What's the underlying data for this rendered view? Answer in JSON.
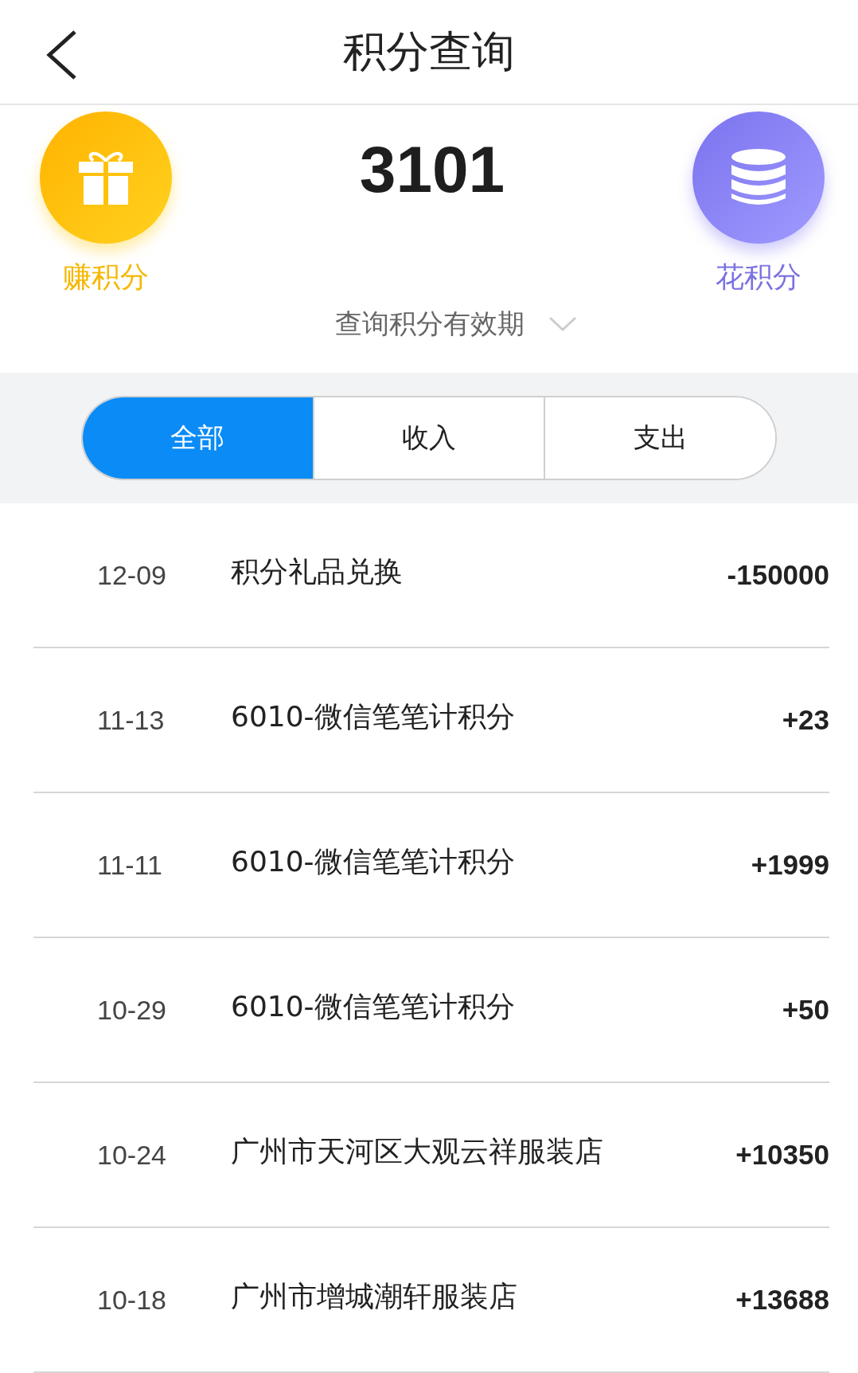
{
  "header": {
    "title": "积分查询"
  },
  "summary": {
    "points": "3101",
    "earn_label": "赚积分",
    "spend_label": "花积分",
    "expiry_link": "查询积分有效期"
  },
  "tabs": [
    {
      "label": "全部",
      "selected": true
    },
    {
      "label": "收入",
      "selected": false
    },
    {
      "label": "支出",
      "selected": false
    }
  ],
  "records": [
    {
      "date": "12-09",
      "description": "积分礼品兑换",
      "amount": "-150000"
    },
    {
      "date": "11-13",
      "description": "6010-微信笔笔计积分",
      "amount": "+23"
    },
    {
      "date": "11-11",
      "description": "6010-微信笔笔计积分",
      "amount": "+1999"
    },
    {
      "date": "10-29",
      "description": "6010-微信笔笔计积分",
      "amount": "+50"
    },
    {
      "date": "10-24",
      "description": "广州市天河区大观云祥服装店",
      "amount": "+10350"
    },
    {
      "date": "10-18",
      "description": "广州市增城潮轩服装店",
      "amount": "+13688"
    }
  ]
}
